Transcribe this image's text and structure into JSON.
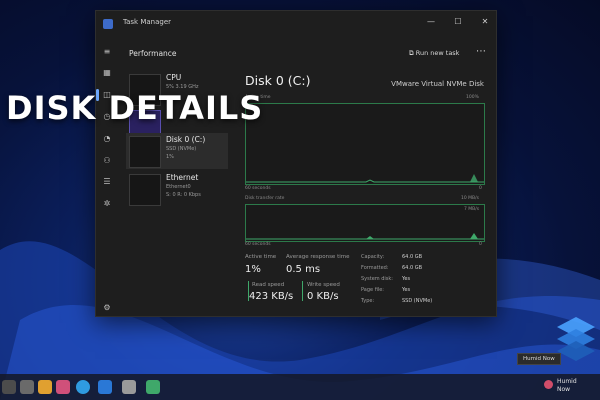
{
  "overlay": {
    "title": "DISK DETAILS"
  },
  "window": {
    "title": "Task Manager",
    "controls": {
      "minimize": "—",
      "maximize": "☐",
      "close": "✕"
    }
  },
  "header": {
    "title": "Performance",
    "run_new_task": "Run new task",
    "more": "⋯"
  },
  "devices": [
    {
      "name": "CPU",
      "sub": "5% 3.19 GHz",
      "sub2": ""
    },
    {
      "name": "",
      "sub": "",
      "sub2": ""
    },
    {
      "name": "Disk 0 (C:)",
      "sub": "SSD (NVMe)",
      "sub2": "1%"
    },
    {
      "name": "Ethernet",
      "sub": "Ethernet0",
      "sub2": "S: 0 R: 0 Kbps"
    }
  ],
  "panel": {
    "title": "Disk 0 (C:)",
    "model": "VMware Virtual NVMe Disk",
    "graph1": {
      "label_left": "Active time",
      "label_right": "100%",
      "axis_left": "60 seconds",
      "axis_right": "0"
    },
    "graph2": {
      "label_left": "Disk transfer rate",
      "label_right": "10 MB/s",
      "label_right2": "7 MB/s",
      "axis_left": "60 seconds",
      "axis_right": "0"
    },
    "stats": {
      "active_time_label": "Active time",
      "active_time_value": "1%",
      "avg_response_label": "Average response time",
      "avg_response_value": "0.5 ms",
      "read_speed_label": "Read speed",
      "read_speed_value": "423 KB/s",
      "write_speed_label": "Write speed",
      "write_speed_value": "0 KB/s"
    },
    "details": [
      {
        "k": "Capacity:",
        "v": "64.0 GB"
      },
      {
        "k": "Formatted:",
        "v": "64.0 GB"
      },
      {
        "k": "System disk:",
        "v": "Yes"
      },
      {
        "k": "Page file:",
        "v": "Yes"
      },
      {
        "k": "Type:",
        "v": "SSD (NVMe)"
      }
    ]
  },
  "taskbar": {
    "tooltip": "Humid Now",
    "weather_line1": "Humid",
    "weather_line2": "Now"
  },
  "colors": {
    "accent_green": "#2c7a4a",
    "accent_blue": "#6ea8ff",
    "window_bg": "#1e1e1e"
  }
}
